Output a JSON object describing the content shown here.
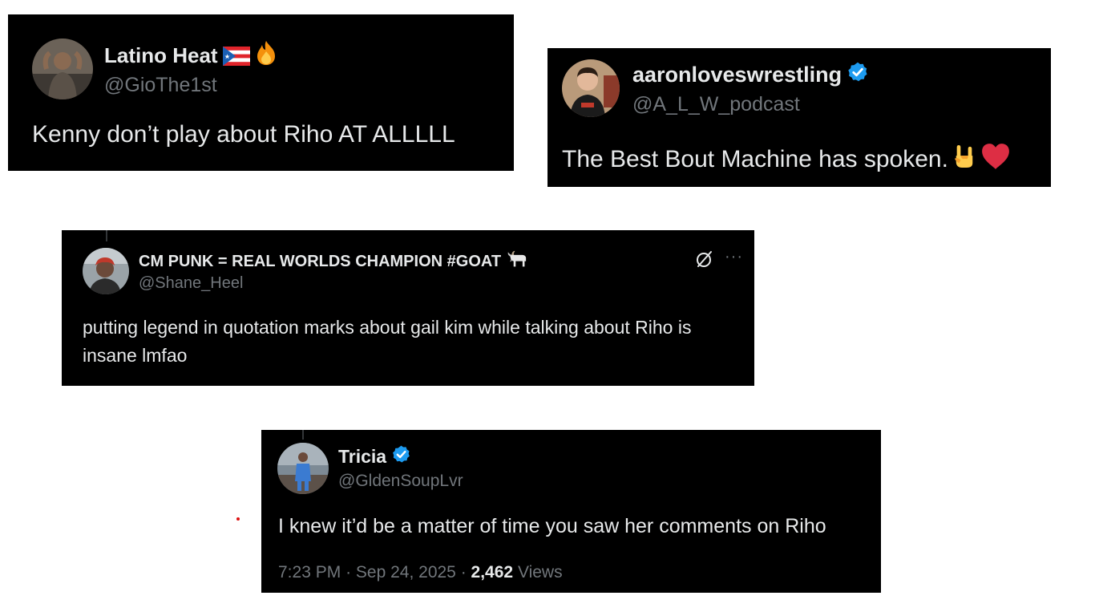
{
  "tweets": [
    {
      "name": "Latino Heat",
      "handle": "@GioThe1st",
      "text": "Kenny don’t play about Riho AT ALLLLL",
      "name_emojis": [
        "puerto-rico-flag",
        "fire"
      ]
    },
    {
      "name": "aaronloveswrestling",
      "handle": "@A_L_W_podcast",
      "text": "The Best Bout Machine has spoken.",
      "verified": true,
      "text_emojis": [
        "sign-of-the-horns",
        "red-heart"
      ]
    },
    {
      "name": "CM PUNK = REAL WORLDS CHAMPION #GOAT",
      "handle": "@Shane_Heel",
      "text": "putting legend in quotation marks about gail kim while talking about Riho is insane lmfao",
      "name_emojis": [
        "goat"
      ],
      "more_label": "···"
    },
    {
      "name": "Tricia",
      "handle": "@GldenSoupLvr",
      "text": "I knew it’d be a matter of time you saw her comments on Riho",
      "verified": true,
      "time": "7:23 PM",
      "date": "Sep 24, 2025",
      "separator": "·",
      "views_count": "2,462",
      "views_label": "Views"
    }
  ],
  "colors": {
    "card_bg": "#000000",
    "text": "#e7e9ea",
    "muted": "#71767b",
    "verified": "#1d9bf0",
    "page_bg": "#ffffff"
  }
}
